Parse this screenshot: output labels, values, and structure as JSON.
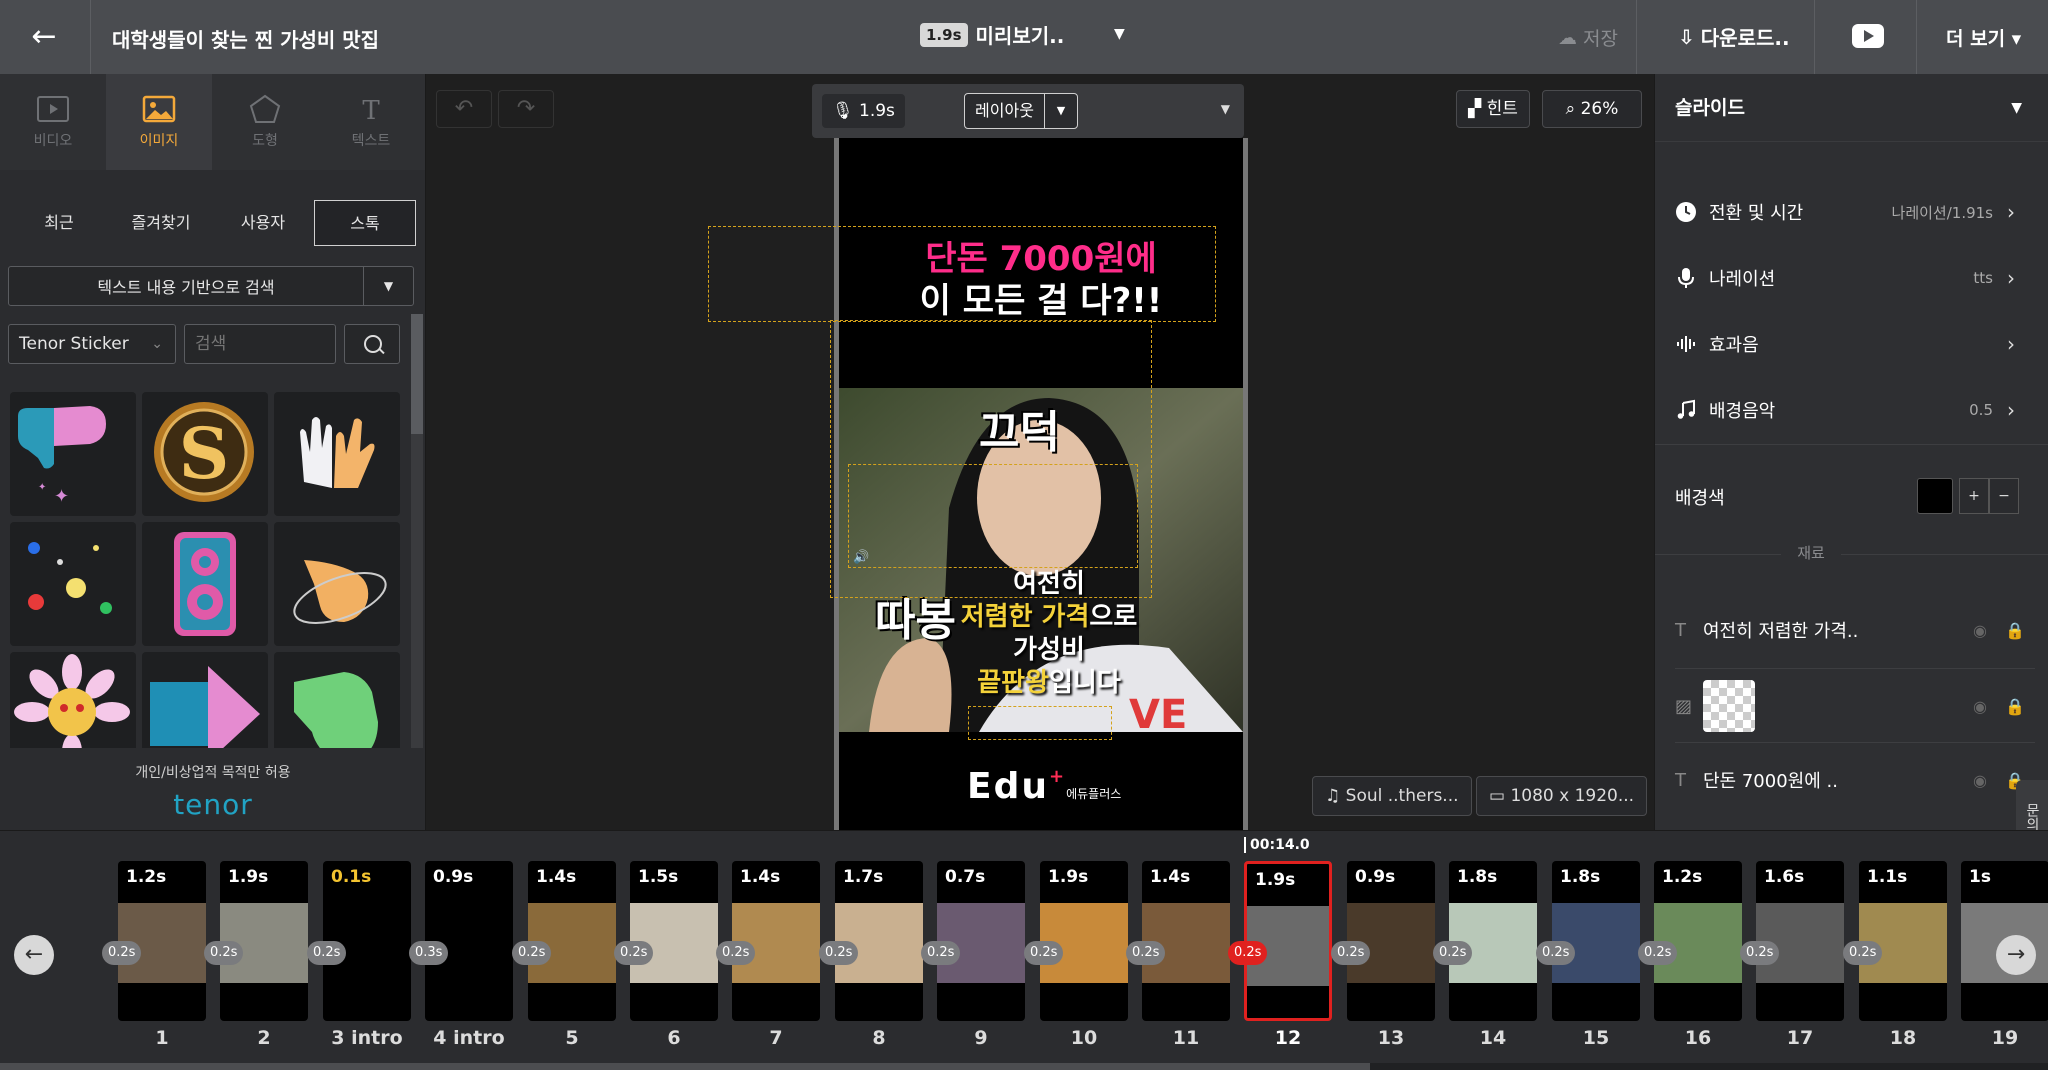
{
  "topbar": {
    "title": "대학생들이 찾는 찐 가성비 맛집",
    "preview_badge": "1.9s",
    "preview_label": "미리보기..",
    "save_label": "저장",
    "download_label": "다운로드..",
    "more_label": "더 보기"
  },
  "left_panel": {
    "tabs": [
      {
        "label": "비디오"
      },
      {
        "label": "이미지"
      },
      {
        "label": "도형"
      },
      {
        "label": "텍스트"
      }
    ],
    "subtabs": [
      "최근",
      "즐겨찾기",
      "사용자",
      "스톡"
    ],
    "search_mode": "텍스트 내용 기반으로 검색",
    "source": "Tenor Sticker",
    "search_placeholder": "검색",
    "license": "개인/비상업적 목적만 허용",
    "brand": "tenor"
  },
  "canvas": {
    "duration": "1.9s",
    "layout_label": "레이아웃",
    "hint_label": "힌트",
    "zoom": "26%",
    "headline_line1": "단돈 7000원에",
    "headline_line2": "이 모든 걸 다?!!",
    "sfx_word1": "끄덕",
    "sfx_word2": "따봉",
    "caption_line1": "여전히",
    "caption_line2_hl": "저렴한 가격",
    "caption_line2_rest": "으로",
    "caption_line3": "가성비",
    "caption_line4_hl": "끝판왕",
    "caption_line4_rest": "입니다",
    "logo": "Edu",
    "logo_sub": "에듀플러스",
    "music": "Soul ..thers...",
    "resolution": "1080 x 1920..."
  },
  "right_panel": {
    "header": "슬라이드",
    "rows": [
      {
        "label": "전환 및 시간",
        "value": "나레이션/1.91s"
      },
      {
        "label": "나레이션",
        "value": "tts"
      },
      {
        "label": "효과음",
        "value": ""
      },
      {
        "label": "배경음악",
        "value": "0.5"
      }
    ],
    "bg_label": "배경색",
    "plus": "+",
    "minus": "−",
    "materials_label": "재료",
    "materials": [
      {
        "type": "T",
        "label": "여전히 저렴한 가격.."
      },
      {
        "type": "image",
        "label": ""
      },
      {
        "type": "T",
        "label": "단돈 7000원에 .."
      }
    ],
    "side_tab": "문의"
  },
  "timeline": {
    "playhead": "00:14.0",
    "slides": [
      {
        "dur": "1.2s",
        "label": "1",
        "trans": "0.2s"
      },
      {
        "dur": "1.9s",
        "label": "2",
        "trans": "0.2s"
      },
      {
        "dur": "0.1s",
        "label": "3 intro",
        "trans": "0.2s"
      },
      {
        "dur": "0.9s",
        "label": "4 intro",
        "trans": "0.3s"
      },
      {
        "dur": "1.4s",
        "label": "5",
        "trans": "0.2s"
      },
      {
        "dur": "1.5s",
        "label": "6",
        "trans": "0.2s"
      },
      {
        "dur": "1.4s",
        "label": "7",
        "trans": "0.2s"
      },
      {
        "dur": "1.7s",
        "label": "8",
        "trans": "0.2s"
      },
      {
        "dur": "0.7s",
        "label": "9",
        "trans": "0.2s"
      },
      {
        "dur": "1.9s",
        "label": "10",
        "trans": "0.2s"
      },
      {
        "dur": "1.4s",
        "label": "11",
        "trans": "0.2s"
      },
      {
        "dur": "1.9s",
        "label": "12",
        "trans": "0.2s"
      },
      {
        "dur": "0.9s",
        "label": "13",
        "trans": "0.2s"
      },
      {
        "dur": "1.8s",
        "label": "14",
        "trans": "0.2s"
      },
      {
        "dur": "1.8s",
        "label": "15",
        "trans": "0.2s"
      },
      {
        "dur": "1.2s",
        "label": "16",
        "trans": "0.2s"
      },
      {
        "dur": "1.6s",
        "label": "17",
        "trans": "0.2s"
      },
      {
        "dur": "1.1s",
        "label": "18",
        "trans": "0.2s"
      },
      {
        "dur": "1s",
        "label": "19",
        "trans": ""
      }
    ],
    "selected_index": 11
  },
  "colors": {
    "accent": "#f4a93a",
    "headline_pink": "#ff2d8a",
    "caption_yellow": "#f4d23a",
    "selection_red": "#e0211f",
    "tenor_blue": "#21a3c4"
  }
}
